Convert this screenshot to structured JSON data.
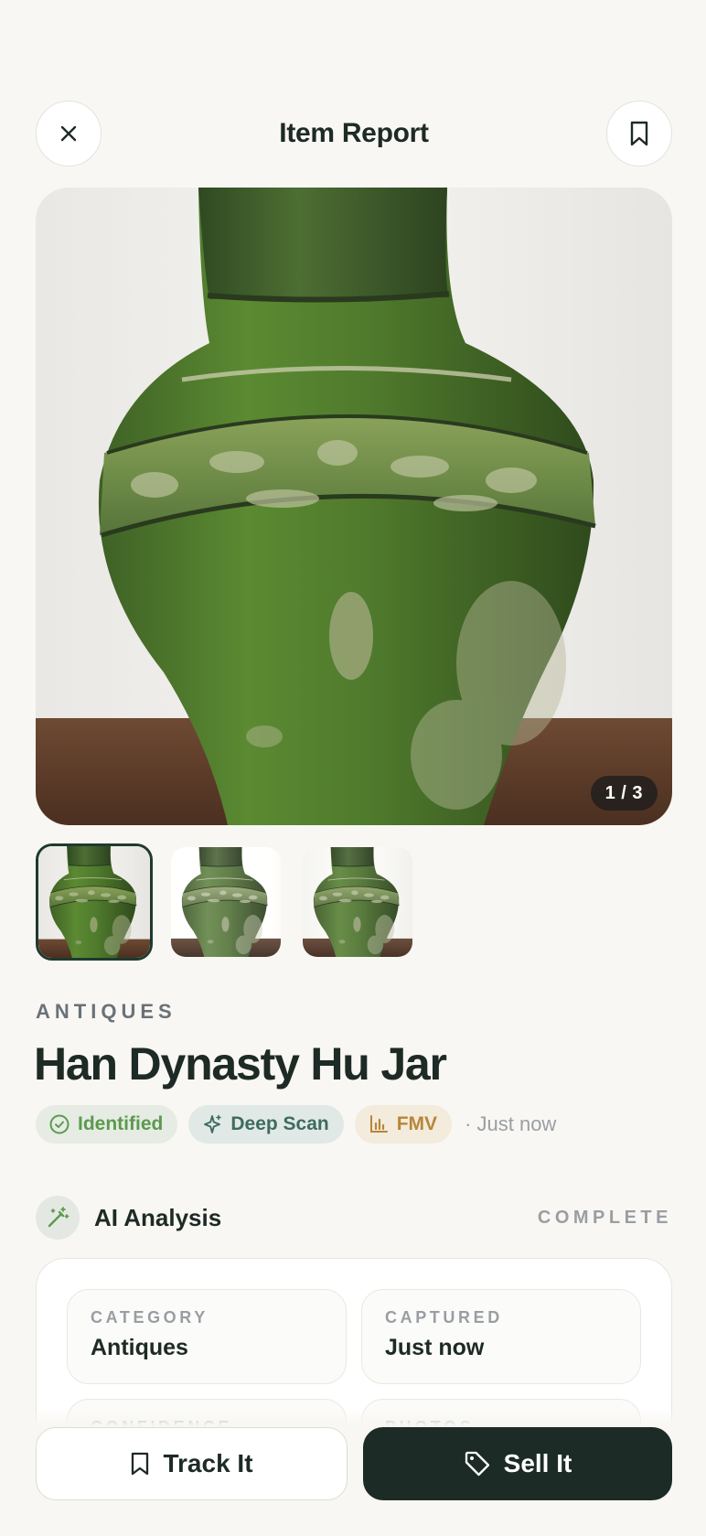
{
  "header": {
    "title": "Item Report",
    "close_icon": "close-icon",
    "bookmark_icon": "bookmark-icon"
  },
  "gallery": {
    "counter": "1 / 3",
    "current_index": 1,
    "total": 3
  },
  "item": {
    "category": "ANTIQUES",
    "name": "Han Dynasty Hu Jar"
  },
  "badges": [
    {
      "label": "Identified",
      "icon": "check-circle-icon",
      "color": "#5b9a4e"
    },
    {
      "label": "Deep Scan",
      "icon": "sparkle-icon",
      "color": "#3e6b60"
    },
    {
      "label": "FMV",
      "icon": "bar-chart-icon",
      "color": "#b7863a"
    }
  ],
  "timestamp": "· Just now",
  "analysis": {
    "icon": "magic-wand-icon",
    "label": "AI Analysis",
    "status": "COMPLETE",
    "fields": [
      {
        "key": "CATEGORY",
        "value": "Antiques"
      },
      {
        "key": "CAPTURED",
        "value": "Just now"
      },
      {
        "key": "CONFIDENCE",
        "value": ""
      },
      {
        "key": "PHOTOS",
        "value": ""
      }
    ]
  },
  "actions": {
    "track_label": "Track It",
    "sell_label": "Sell It"
  },
  "colors": {
    "background": "#f8f7f3",
    "primary_dark": "#1c2b26",
    "muted_text": "#9a9ea3"
  }
}
